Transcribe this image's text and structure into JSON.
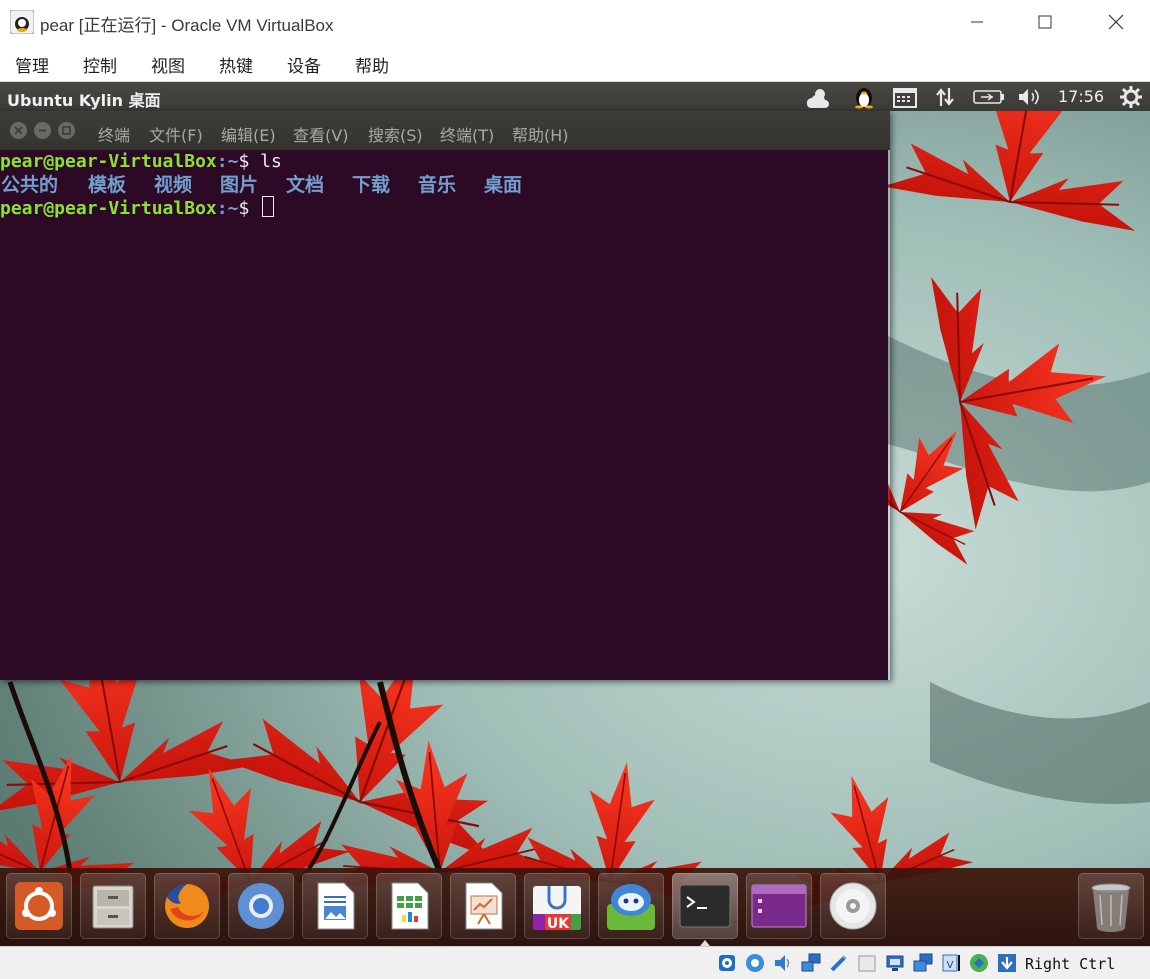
{
  "window": {
    "title": "pear [正在运行] - Oracle VM VirtualBox",
    "menu": [
      "管理",
      "控制",
      "视图",
      "热键",
      "设备",
      "帮助"
    ]
  },
  "guest": {
    "panel_title": "Ubuntu Kylin 桌面",
    "clock": "17:56",
    "tray_icons": [
      "weather-icon",
      "qq-penguin-icon",
      "calendar-icon",
      "network-arrows-icon",
      "battery-icon",
      "volume-icon",
      "settings-gear-icon"
    ],
    "terminal": {
      "menu": [
        "终端",
        "文件(F)",
        "编辑(E)",
        "查看(V)",
        "搜索(S)",
        "终端(T)",
        "帮助(H)"
      ],
      "prompt_user": "pear@pear-VirtualBox",
      "prompt_path": ":~",
      "prompt_symbol": "$ ",
      "command": "ls",
      "ls_output": [
        "公共的",
        "模板",
        "视频",
        "图片",
        "文档",
        "下载",
        "音乐",
        "桌面"
      ]
    },
    "dock": [
      "ubuntu-dash-icon",
      "file-manager-icon",
      "firefox-icon",
      "chromium-icon",
      "writer-icon",
      "calc-icon",
      "impress-icon",
      "ubuntu-kylin-software-icon",
      "app-store-icon",
      "terminal-icon",
      "workspace-switcher-icon",
      "dvd-icon",
      "trash-icon"
    ],
    "active_dock_item": "terminal-icon"
  },
  "statusbar": {
    "host_key": "Right Ctrl"
  },
  "colors": {
    "terminal_bg": "#2c0a26",
    "prompt_user": "#8ae234",
    "ls_dir": "#729fcf"
  }
}
